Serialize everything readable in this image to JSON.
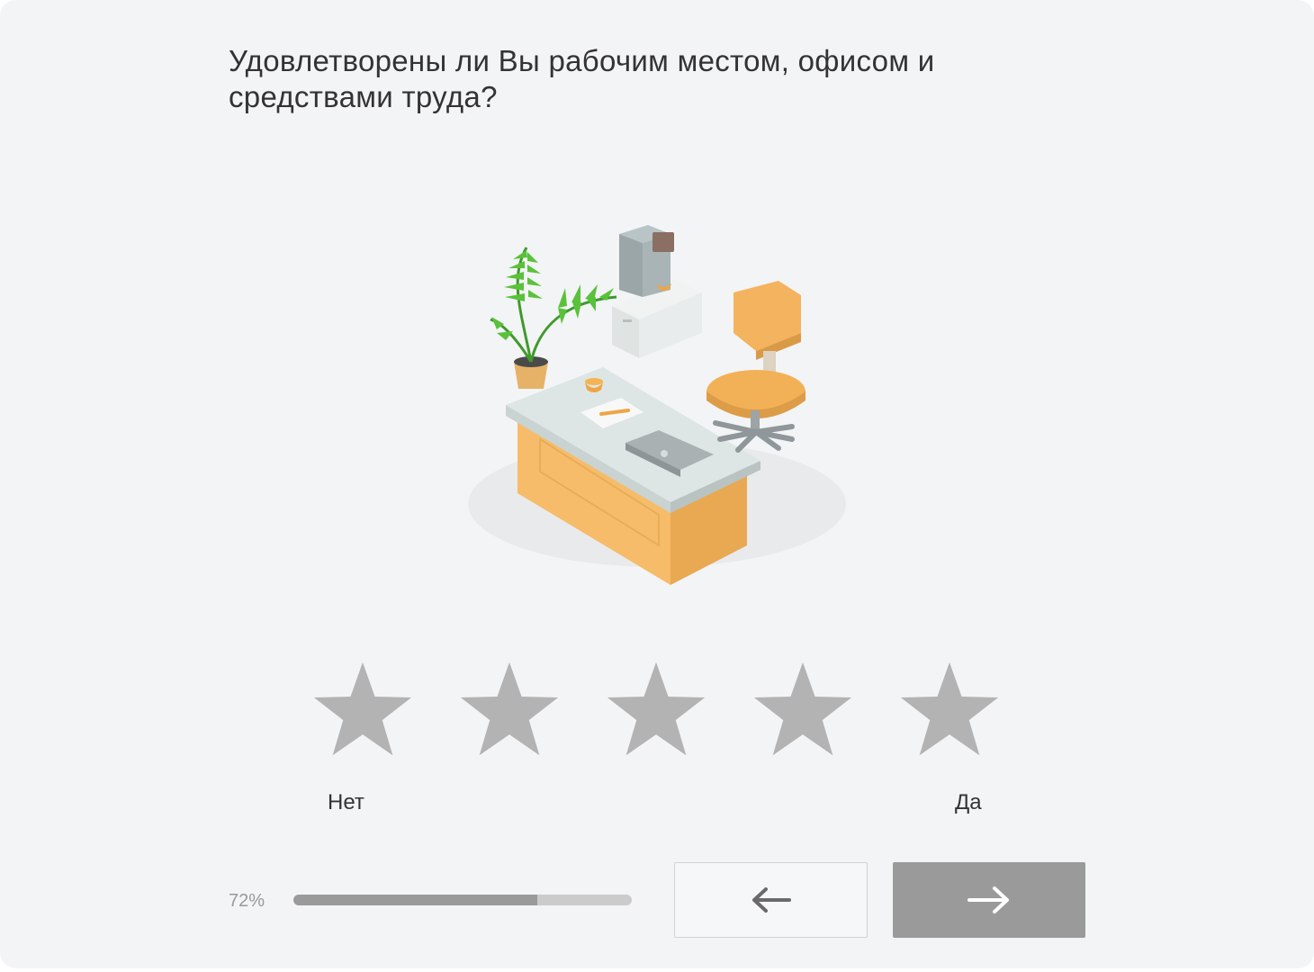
{
  "survey": {
    "question": "Удовлетворены ли Вы рабочим местом, офисом и средствами труда?",
    "illustration_icon": "office-workplace-illustration",
    "rating": {
      "max": 5,
      "selected": 0,
      "star_color": "#b3b3b3",
      "label_min": "Нет",
      "label_max": "Да"
    },
    "progress": {
      "percent_text": "72%",
      "value": 0.72
    },
    "navigation": {
      "back_icon": "arrow-left-icon",
      "next_icon": "arrow-right-icon"
    }
  }
}
